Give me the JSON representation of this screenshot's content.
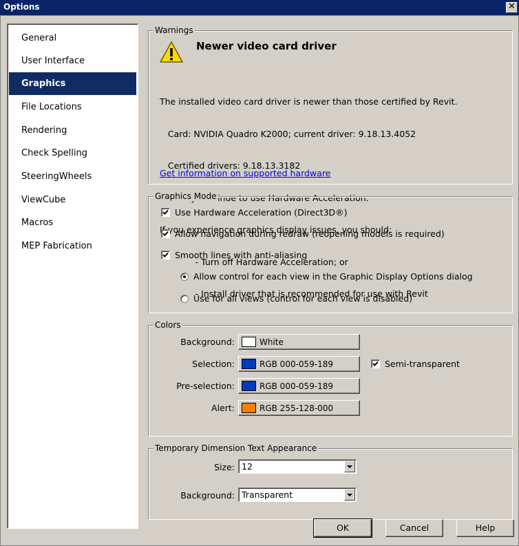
{
  "window": {
    "title": "Options",
    "close_glyph": "✕"
  },
  "sidebar": {
    "items": [
      {
        "label": "General"
      },
      {
        "label": "User Interface"
      },
      {
        "label": "Graphics",
        "active": true
      },
      {
        "label": "File Locations"
      },
      {
        "label": "Rendering"
      },
      {
        "label": "Check Spelling"
      },
      {
        "label": "SteeringWheels"
      },
      {
        "label": "ViewCube"
      },
      {
        "label": "Macros"
      },
      {
        "label": "MEP Fabrication"
      }
    ]
  },
  "warnings": {
    "group_label": "Warnings",
    "icon": "warning-triangle-icon",
    "title": "Newer video card driver",
    "lines": [
      "The installed video card driver is newer than those certified by Revit.",
      "   Card: NVIDIA Quadro K2000; current driver: 9.18.13.4052",
      "   Certified drivers: 9.18.13.3182",
      "You may continue to use Hardware Acceleration.",
      "If you experience graphics display issues, you should:",
      "             - Turn off Hardware Acceleration; or",
      "             - Install driver that is recommended for use with Revit"
    ],
    "link": "Get information on supported hardware"
  },
  "graphics_mode": {
    "group_label": "Graphics Mode",
    "hw_accel": {
      "label": "Use Hardware Acceleration (Direct3D®)",
      "checked": true
    },
    "nav_redraw": {
      "label": "Allow navigation during redraw (reopening models is required)",
      "checked": true
    },
    "smooth_lines": {
      "label": "Smooth lines with anti-aliasing",
      "checked": true
    },
    "radio_per_view": {
      "label": "Allow control for each view in the Graphic Display Options dialog",
      "selected": true
    },
    "radio_all_views": {
      "label": "Use for all views (control for each view is disabled)",
      "selected": false
    }
  },
  "colors": {
    "group_label": "Colors",
    "background": {
      "label": "Background:",
      "value": "White",
      "color": "#ffffff"
    },
    "selection": {
      "label": "Selection:",
      "value": "RGB 000-059-189",
      "color": "#003bbd"
    },
    "preselection": {
      "label": "Pre-selection:",
      "value": "RGB 000-059-189",
      "color": "#003bbd"
    },
    "alert": {
      "label": "Alert:",
      "value": "RGB 255-128-000",
      "color": "#ff8000"
    },
    "semi_transparent": {
      "label": "Semi-transparent",
      "checked": true
    }
  },
  "temp_dim": {
    "group_label": "Temporary Dimension Text Appearance",
    "size": {
      "label": "Size:",
      "value": "12"
    },
    "background": {
      "label": "Background:",
      "value": "Transparent"
    }
  },
  "footer": {
    "ok": "OK",
    "cancel": "Cancel",
    "help": "Help"
  }
}
